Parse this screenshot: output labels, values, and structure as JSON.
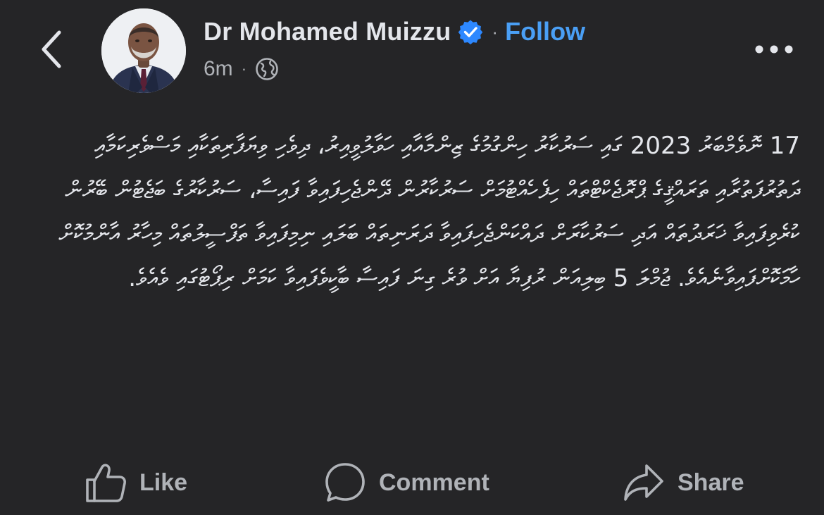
{
  "header": {
    "author_name": "Dr Mohamed Muizzu",
    "separator": "·",
    "follow_label": "Follow",
    "timestamp": "6m",
    "meta_separator": "·",
    "audience_icon": "globe-icon",
    "back_icon": "chevron-left-icon",
    "more_icon": "more-horizontal-icon",
    "verified_icon": "verified-badge-icon"
  },
  "post": {
    "text": "17 ނޮވެމްބަރު 2023 ގައި ސަރުކާރު ހިންގުމުގެ ޒިންމާއާއި ހަވާލުވީއިރު، ދިވެހި ވިޔަފާރިތަކާއި މަސްވެރިކަމާއި ދަތުރުފަތުރާއި ތަރައްޤީގެ ޕްރޮޖެކްޓްތައް ހިފެހެއްޓުމަށް ސަރުކާރުން ދޭންޖެހިފައިވާ ފައިސާ، ސަރުކާރުގެ ބަޖެޓުން ބޭރުން ކުރެވިފައިވާ ޚަރަދުތައް އަދި ސަރުކާރަށް ދައްކަންޖެހިފައިވާ ދަރަނިތައް ބަލައި ނިމިފައިވާ ތަފްސީލުތައް މިހާރު އާންމުކޮށް ހާމަކޮށްފައިވާނެއެވެ. ޖުމްލަ 5 ބިލިއަން ރުފިޔާ އަށް ވުރެ ގިނަ ފައިސާ ބާކީވެފައިވާ ކަމަށް ރިޕޯޓުގައި ވެއެވެ.",
    "colors": {
      "background": "#252527",
      "text": "#e4e6eb",
      "secondary": "#b0b3b8",
      "accent": "#4a9ff5"
    }
  },
  "actions": {
    "like": {
      "label": "Like",
      "icon": "thumbs-up-icon"
    },
    "comment": {
      "label": "Comment",
      "icon": "speech-bubble-icon"
    },
    "share": {
      "label": "Share",
      "icon": "share-arrow-icon"
    }
  }
}
